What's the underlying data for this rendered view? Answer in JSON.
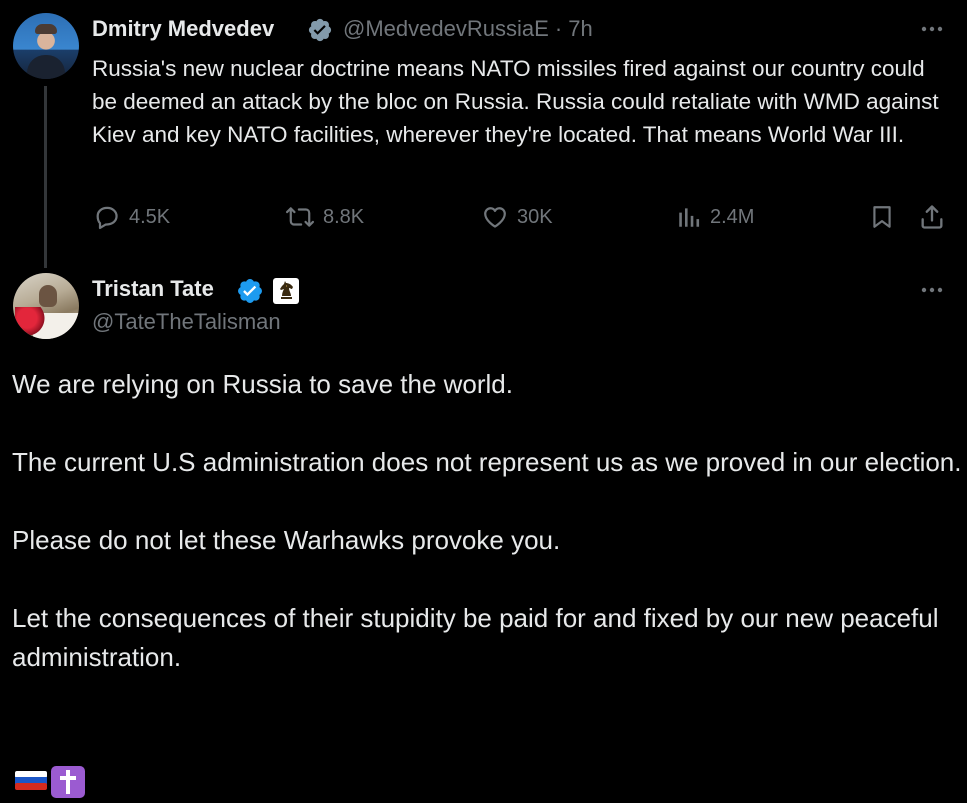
{
  "parent_tweet": {
    "author_name": "Dmitry Medvedev",
    "author_handle_time": "@MedvedevRussiaE · 7h",
    "text": "Russia's new nuclear doctrine means NATO missiles fired against our country could be deemed an attack by the bloc on Russia. Russia could retaliate with WMD against Kiev and key NATO facilities, wherever they're located. That means World War III.",
    "badge_icon": "verified-gray-icon",
    "stats": {
      "replies": "4.5K",
      "reposts": "8.8K",
      "likes": "30K",
      "views": "2.4M"
    }
  },
  "main_tweet": {
    "author_name": "Tristan Tate",
    "author_handle": "@TateTheTalisman",
    "badge_icon": "verified-blue-icon",
    "affiliation_icon": "chess-knight-icon",
    "paragraphs": [
      "We are relying on Russia to save the world.",
      "The current U.S administration does not represent us as we proved in our election.",
      "Please do not let these Warhawks provoke you.",
      "Let the consequences of their stupidity be paid for and fixed by our new peaceful administration."
    ],
    "emojis": [
      "russia-flag",
      "latin-cross"
    ]
  },
  "colors": {
    "background": "#000000",
    "text_primary": "#e7e9ea",
    "text_secondary": "#71767b",
    "thread_line": "#333639",
    "verified_blue": "#1d9bf0",
    "verified_gray": "#829aab"
  }
}
